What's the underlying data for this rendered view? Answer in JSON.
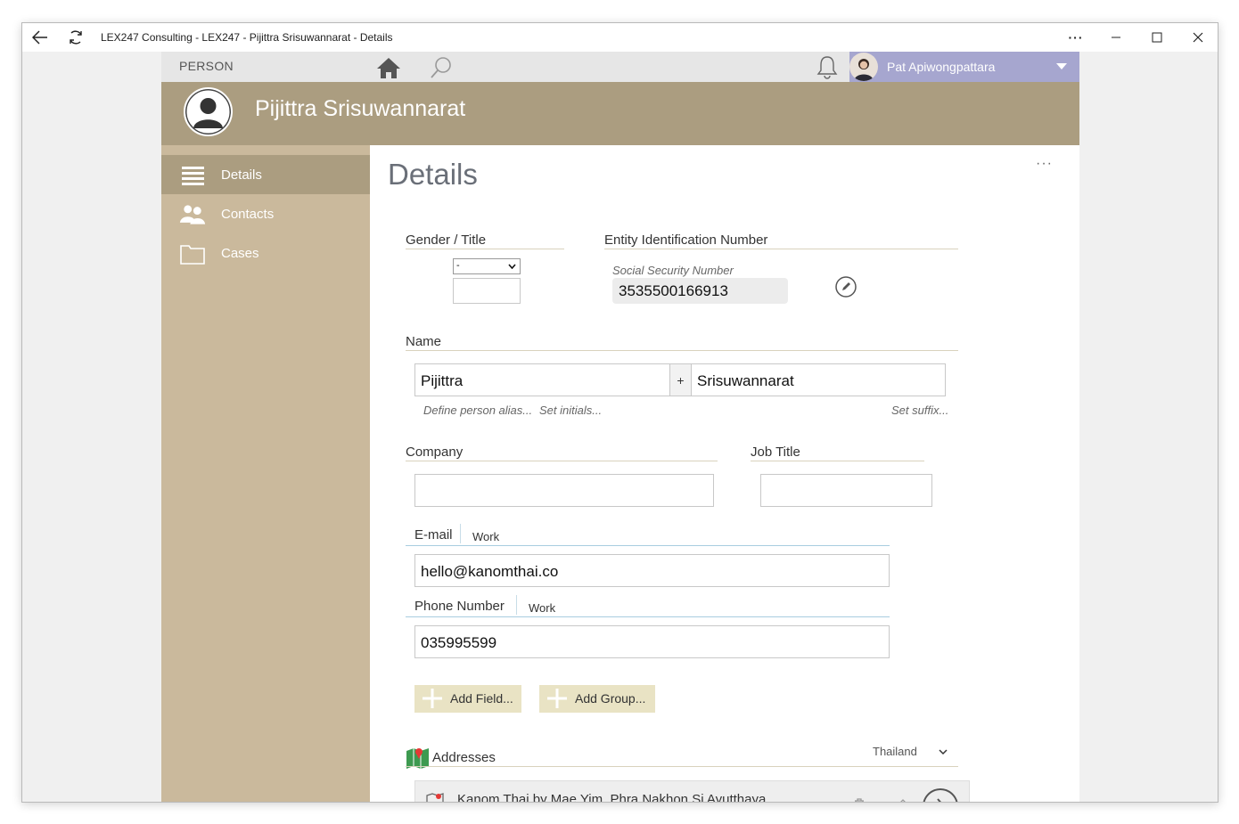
{
  "window": {
    "title": "LEX247 Consulting - LEX247 - Pijittra Srisuwannarat - Details"
  },
  "topbar": {
    "section": "PERSON",
    "user_name": "Pat Apiwongpattara"
  },
  "header": {
    "person_name": "Pijittra Srisuwannarat"
  },
  "sidebar": {
    "items": [
      {
        "label": "Details",
        "icon": "list-icon",
        "active": true
      },
      {
        "label": "Contacts",
        "icon": "people-icon",
        "active": false
      },
      {
        "label": "Cases",
        "icon": "folder-icon",
        "active": false
      }
    ]
  },
  "main": {
    "title": "Details",
    "more": "···",
    "gender_title_label": "Gender / Title",
    "gender_value": "-",
    "title_value": "",
    "entity_id_label": "Entity Identification Number",
    "ssn_label": "Social Security Number",
    "ssn_value": "3535500166913",
    "name_label": "Name",
    "first_name": "Pijittra",
    "plus": "+",
    "last_name": "Srisuwannarat",
    "define_alias": "Define person alias...",
    "set_initials": "Set initials...",
    "set_suffix": "Set suffix...",
    "company_label": "Company",
    "company_value": "",
    "job_title_label": "Job Title",
    "job_title_value": "",
    "email_label": "E-mail",
    "email_type": "Work",
    "email_value": "hello@kanomthai.co",
    "phone_label": "Phone Number",
    "phone_type": "Work",
    "phone_value": "035995599",
    "add_field": "Add Field...",
    "add_group": "Add Group...",
    "addresses_label": "Addresses",
    "country": "Thailand",
    "address_line": "Kanom Thai by Mae Yim, Phra Nakhon Si Ayutthaya"
  },
  "colors": {
    "header": "#ab9d80",
    "sidebar": "#cab99c",
    "user_bar": "#a6a6cf",
    "add_button": "#e9e3c4"
  }
}
